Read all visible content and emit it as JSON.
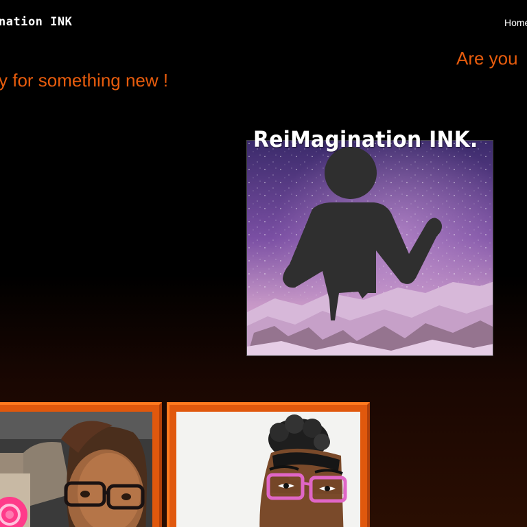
{
  "header": {
    "brand": "nation INK",
    "nav_home": "Home"
  },
  "hero": {
    "tagline_line1": "Are you",
    "tagline_line2": "y for something new !"
  },
  "logo": {
    "title": "ReiMagination INK."
  },
  "gallery": {
    "items": [
      {
        "name": "selfie-photo"
      },
      {
        "name": "cartoon-portrait"
      }
    ]
  },
  "colors": {
    "accent": "#e85c0d",
    "frame": "#e0580d",
    "background": "#000000"
  }
}
